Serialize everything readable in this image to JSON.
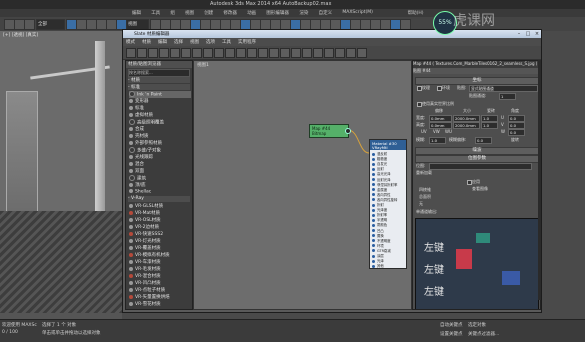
{
  "app": {
    "title": "Autodesk 3ds Max 2014 x64     AutoBackup02.max",
    "menu": [
      "编辑",
      "工具",
      "组",
      "视图",
      "创建",
      "修改器",
      "动画",
      "图形编辑器",
      "渲染",
      "自定义",
      "MAXScript(M)",
      "帮助(H)"
    ],
    "viewport_label": "[+] [透视] [真实]",
    "toolbar_dropdown": "全部",
    "view_dropdown": "视图"
  },
  "slate": {
    "title": "Slate 材质编辑器",
    "menu": [
      "模式",
      "材质",
      "编辑",
      "选择",
      "视图",
      "选项",
      "工具",
      "实用程序"
    ],
    "browser_header": "材质/贴图浏览器",
    "search_placeholder": "按名称搜索...",
    "categories": [
      {
        "label": "- 材质",
        "top": 0
      },
      {
        "label": "- 标准",
        "top": 0
      }
    ],
    "standard_materials": [
      "Ink 'n Paint",
      "变形器",
      "标准",
      "虚拟材质",
      "高级照明覆盖",
      "合成",
      "壳材质",
      "外部参照材质",
      "多维/子对象",
      "光线跟踪",
      "混合",
      "双面",
      "建筑",
      "顶/底",
      "Shellac"
    ],
    "vray_header": "- V-Ray",
    "vray_materials": [
      "VR-GLSL材质",
      "VR-Mat材质",
      "VR-OSL材质",
      "VR-2边材质",
      "VR-快速SSS2",
      "VR-灯光材质",
      "VR-覆盖材质",
      "VR-模拟有机材质",
      "VR-车漆材质",
      "VR-毛发材质",
      "VR-混合材质",
      "VR-凹凸材质",
      "VR-点粒子材质",
      "VR-矢量置换烘焙",
      "VR-雪花材质"
    ],
    "view_tab": "视图1",
    "node_bitmap_title": "Map #44",
    "node_bitmap_sub": "Bitmap",
    "node_material_title": "Material #30",
    "node_material_sub": "VRayMtl",
    "material_slots": [
      "漫反射",
      "粗糙度",
      "自发光",
      "反射",
      "高光光泽",
      "反射光泽",
      "菲涅耳折射率",
      "金属度",
      "各向异性",
      "各向异性旋转",
      "折射",
      "光泽度",
      "折射率",
      "半透明",
      "雾颜色",
      "凹凸",
      "置换",
      "不透明度",
      "环境",
      "GTR衰减",
      "涂层",
      "光泽",
      "其他"
    ],
    "nav_label": "导航器"
  },
  "params": {
    "header": "Map #44 ( Textures.Com_MarbleTiles0162_2_seamless_S.jpg )",
    "sub_header": "贴图 #44",
    "section_coords": "坐标",
    "tex_label": "纹理",
    "env_label": "环境",
    "mapping_label": "贴图:",
    "mapping_value": "显式贴图通道",
    "map_channel_label": "贴图通道:",
    "map_channel_value": "1",
    "show_in_viewport": "使用真实世界比例",
    "offset_label": "偏移",
    "size_label": "大小",
    "tiling_label": "瓷砖",
    "angle_label": "角度",
    "width_label": "宽度:",
    "height_label": "高度:",
    "u_label": "U",
    "v_label": "V",
    "w_label": "W",
    "offset_u": "0.0mm",
    "offset_v": "0.0mm",
    "size_w": "2000.0mm",
    "size_h": "2000.0mm",
    "tile_u": "1.0",
    "tile_v": "1.0",
    "angle_u": "0.0",
    "angle_v": "0.0",
    "angle_w": "0.0",
    "uv_options": [
      "UV",
      "VW",
      "WU"
    ],
    "blur_label": "模糊:",
    "blur_value": "1.0",
    "blur_offset_label": "模糊偏移:",
    "blur_offset_value": "0.0",
    "rotate_label": "旋转",
    "section_noise": "噪波",
    "section_bitmap": "位图参数",
    "bitmap_label": "位图:",
    "apply_label": "应用",
    "view_image": "查看图像",
    "filter_labels": [
      "四棱锥",
      "总面积",
      "无"
    ],
    "mono_label": "单通道输出:",
    "preview_text": [
      "左键",
      "左键",
      "左键"
    ],
    "reload_label": "重新加载"
  },
  "status": {
    "selection": "选择了 1 个 对象",
    "hint": "单击或单击并拖动以选择对象",
    "frames": "0 / 100",
    "welcome": "欢迎使用 MAXSc",
    "auto_key": "自动关键点",
    "set_key": "设置关键点",
    "selected": "选定对象",
    "key_filter": "关键点过滤器..."
  },
  "overlay": {
    "badge": "55%",
    "watermark": "虎课网"
  },
  "colors": {
    "bitmap_node": "#55b069",
    "material_node_header": "#2f5f95",
    "wire": "#d8a23a",
    "highlight": "#e07f1a"
  }
}
